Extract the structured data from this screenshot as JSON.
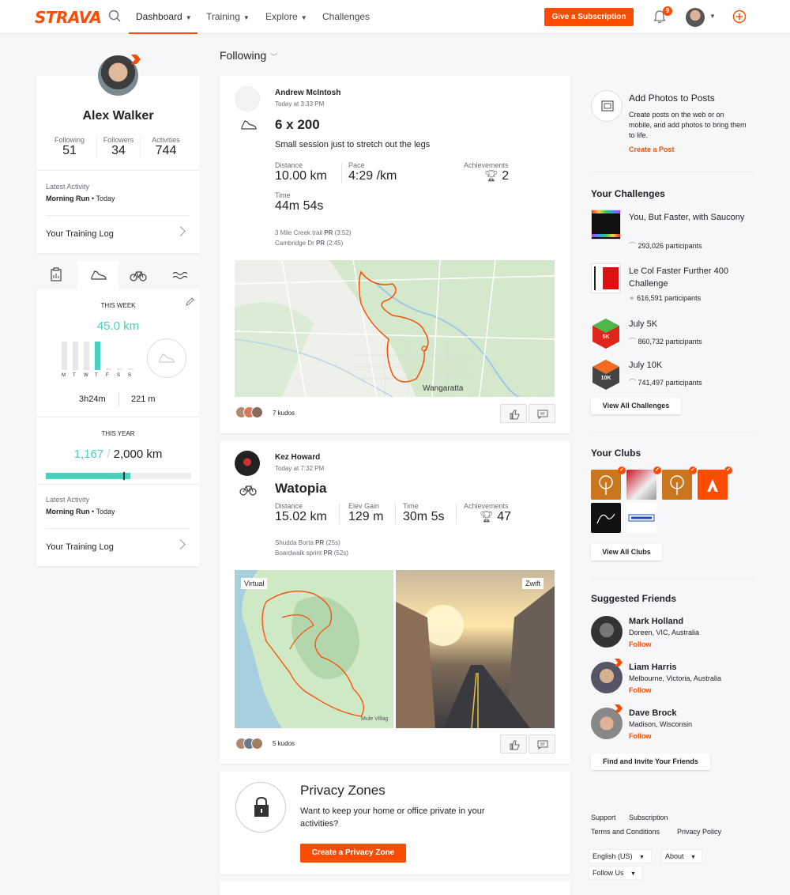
{
  "nav": {
    "logo": "STRAVA",
    "items": [
      {
        "label": "Dashboard"
      },
      {
        "label": "Training"
      },
      {
        "label": "Explore"
      },
      {
        "label": "Challenges"
      }
    ],
    "subscribe_label": "Give a Subscription",
    "notifications_count": "9",
    "accent": "#fc4c02"
  },
  "profile": {
    "name": "Alex Walker",
    "following_label": "Following",
    "following": "51",
    "followers_label": "Followers",
    "followers": "34",
    "activities_label": "Activities",
    "activities": "744",
    "latest_label": "Latest Activity",
    "latest_name": "Morning Run",
    "latest_when": " • Today",
    "training_log": "Your Training Log"
  },
  "weekly": {
    "this_week": "THIS WEEK",
    "distance": "45.0 km",
    "days": [
      "M",
      "T",
      "W",
      "T",
      "F",
      "S",
      "S"
    ],
    "day_levels": [
      0.95,
      0.95,
      0.95,
      0.95,
      0,
      0,
      0
    ],
    "time": "3h24m",
    "elevation": "221 m",
    "this_year": "THIS YEAR",
    "year_done": "1,167",
    "year_goal": "2,000 km",
    "year_progress": 0.58,
    "latest_label": "Latest Activity",
    "latest_name": "Morning Run",
    "latest_when": " • Today",
    "training_log": "Your Training Log"
  },
  "feed": {
    "filter": "Following",
    "post1": {
      "athlete": "Andrew McIntosh",
      "when": "Today at 3:33 PM",
      "title": "6 x 200",
      "description": "Small session just to stretch out the legs",
      "distance_label": "Distance",
      "distance": "10.00 km",
      "pace_label": "Pace",
      "pace": "4:29 /km",
      "achievements_label": "Achievements",
      "achievements": "2",
      "time_label": "Time",
      "time": "44m 54s",
      "seg1_name": "3 Mile Creek trail ",
      "seg1_pr": "PR",
      "seg1_time": " (3:52)",
      "seg2_name": "Cambridge Dr ",
      "seg2_pr": "PR",
      "seg2_time": " (2:45)",
      "map_town": "Wangaratta",
      "kudos": "7 kudos"
    },
    "post2": {
      "athlete": "Kez Howard",
      "when": "Today at 7:32 PM",
      "title": "Watopia",
      "distance_label": "Distance",
      "distance": "15.02 km",
      "elev_label": "Elev Gain",
      "elev": "129 m",
      "time_label": "Time",
      "time": "30m 5s",
      "achievements_label": "Achievements",
      "achievements": "47",
      "seg1_name": "Shudda Borta ",
      "seg1_pr": "PR",
      "seg1_time": " (25s)",
      "seg2_name": "Boardwalk sprint ",
      "seg2_pr": "PR",
      "seg2_time": " (52s)",
      "tag_virtual": "Virtual",
      "tag_zwift": "Zwift",
      "map_place": "Mule Villag",
      "kudos": "5 kudos"
    },
    "privacy": {
      "title": "Privacy Zones",
      "text": "Want to keep your home or office private in your activities?",
      "button": "Create a Privacy Zone"
    }
  },
  "right": {
    "photos_title": "Add Photos to Posts",
    "photos_text": "Create posts on the web or on mobile, and add photos to bring them to life.",
    "photos_link": "Create a Post",
    "challenges_title": "Your Challenges",
    "challenges": [
      {
        "name": "You, But Faster, with Saucony",
        "participants": "293,026 participants"
      },
      {
        "name": "Le Col Faster Further 400 Challenge",
        "participants": "616,591 participants"
      },
      {
        "name": "July 5K",
        "participants": "860,732 participants"
      },
      {
        "name": "July 10K",
        "participants": "741,497 participants"
      }
    ],
    "view_challenges": "View All Challenges",
    "clubs_title": "Your Clubs",
    "view_clubs": "View All Clubs",
    "friends_title": "Suggested Friends",
    "friends": [
      {
        "name": "Mark Holland",
        "location": "Doreen, VIC, Australia",
        "follow": "Follow"
      },
      {
        "name": "Liam Harris",
        "location": "Melbourne, Victoria, Australia",
        "follow": "Follow"
      },
      {
        "name": "Dave Brock",
        "location": "Madison, Wisconsin",
        "follow": "Follow"
      }
    ],
    "invite": "Find and Invite Your Friends",
    "footer": {
      "support": "Support",
      "subscription": "Subscription",
      "terms": "Terms and Conditions",
      "privacy": "Privacy Policy",
      "language": "English (US)",
      "about": "About",
      "follow_us": "Follow Us"
    }
  }
}
